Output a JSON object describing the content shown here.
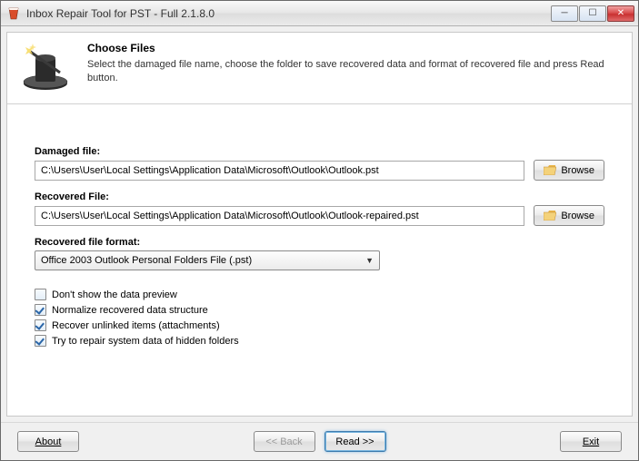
{
  "window": {
    "title": "Inbox Repair Tool for PST - Full 2.1.8.0"
  },
  "header": {
    "title": "Choose Files",
    "description": "Select the damaged file name, choose the folder to save recovered data and format of recovered file and press Read button."
  },
  "form": {
    "damaged_label": "Damaged file:",
    "damaged_value": "C:\\Users\\User\\Local Settings\\Application Data\\Microsoft\\Outlook\\Outlook.pst",
    "recovered_label": "Recovered File:",
    "recovered_value": "C:\\Users\\User\\Local Settings\\Application Data\\Microsoft\\Outlook\\Outlook-repaired.pst",
    "browse_label": "Browse",
    "format_label": "Recovered file format:",
    "format_value": "Office 2003 Outlook Personal Folders File (.pst)"
  },
  "options": {
    "preview": {
      "label": "Don't show the data preview",
      "checked": false
    },
    "normalize": {
      "label": "Normalize recovered data structure",
      "checked": true
    },
    "unlinked": {
      "label": "Recover unlinked items (attachments)",
      "checked": true
    },
    "hidden": {
      "label": "Try to repair system data of hidden folders",
      "checked": true
    }
  },
  "footer": {
    "about": "About",
    "back": "<< Back",
    "read": "Read >>",
    "exit": "Exit"
  }
}
